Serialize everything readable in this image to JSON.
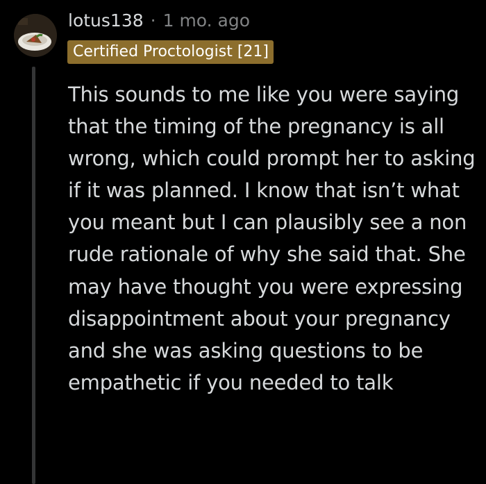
{
  "comment": {
    "author": "lotus138",
    "separator": "·",
    "time_ago": "1 mo. ago",
    "flair": "Certified Proctologist [21]",
    "body": "This sounds to me like you were saying that the timing of the pregnancy is all wrong, which could prompt her to asking if it was planned. I know that isn’t what you meant but I can plausibly see a non rude rationale of why she said that. She may have thought you were expressing disappointment about your pregnancy and she was asking questions to be empathetic if you needed to talk"
  },
  "colors": {
    "background": "#000000",
    "text": "#d7dadc",
    "muted": "#818384",
    "flair_bg": "#8c6e2d",
    "thread_line": "#343536"
  }
}
